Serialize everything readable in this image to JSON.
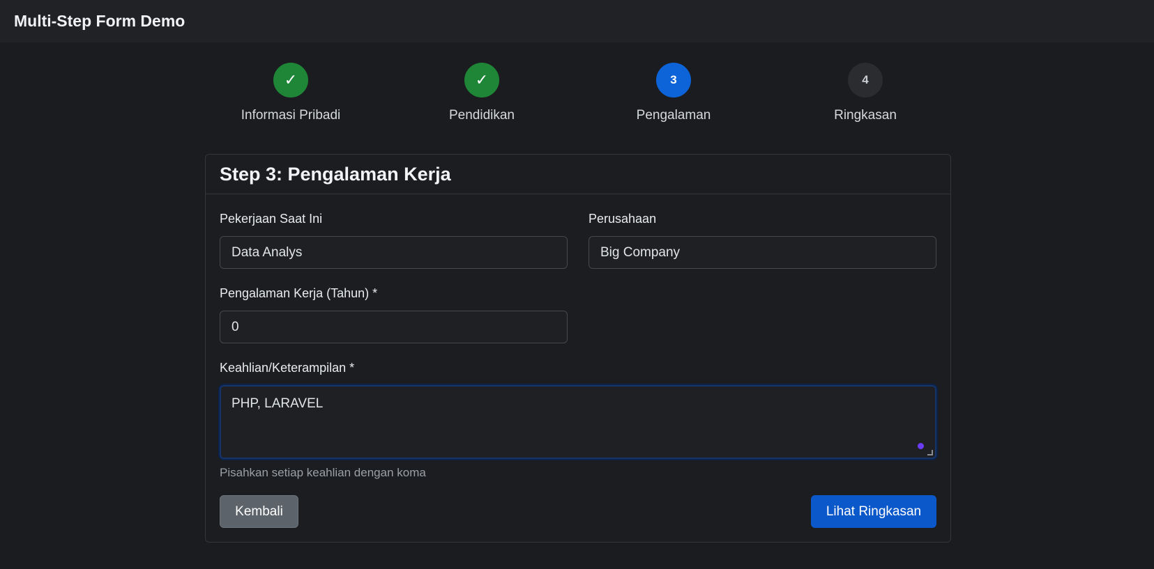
{
  "app": {
    "title": "Multi-Step Form Demo"
  },
  "steps": [
    {
      "label": "Informasi Pribadi",
      "marker": "✓",
      "state": "done"
    },
    {
      "label": "Pendidikan",
      "marker": "✓",
      "state": "done"
    },
    {
      "label": "Pengalaman",
      "marker": "3",
      "state": "active"
    },
    {
      "label": "Ringkasan",
      "marker": "4",
      "state": "todo"
    }
  ],
  "form": {
    "title": "Step 3: Pengalaman Kerja",
    "current_job": {
      "label": "Pekerjaan Saat Ini",
      "value": "Data Analys"
    },
    "company": {
      "label": "Perusahaan",
      "value": "Big Company"
    },
    "experience_years": {
      "label": "Pengalaman Kerja (Tahun) *",
      "value": "0"
    },
    "skills": {
      "label": "Keahlian/Keterampilan *",
      "value": "PHP, LARAVEL",
      "help": "Pisahkan setiap keahlian dengan koma"
    }
  },
  "actions": {
    "back_label": "Kembali",
    "summary_label": "Lihat Ringkasan"
  },
  "colors": {
    "step_done": "#1f8637",
    "step_active": "#0d64d8",
    "primary_button": "#0b58ca",
    "secondary_button": "#5c636a"
  }
}
